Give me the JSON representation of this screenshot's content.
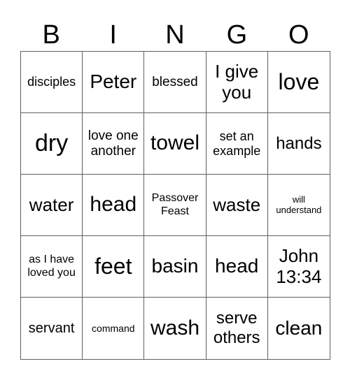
{
  "header": [
    "B",
    "I",
    "N",
    "G",
    "O"
  ],
  "cells": [
    {
      "text": "disciples",
      "size": "s18"
    },
    {
      "text": "Peter",
      "size": "s28"
    },
    {
      "text": "blessed",
      "size": "s19"
    },
    {
      "text": "I give you",
      "size": "s26"
    },
    {
      "text": "love",
      "size": "s32"
    },
    {
      "text": "dry",
      "size": "s34"
    },
    {
      "text": "love one another",
      "size": "s19"
    },
    {
      "text": "towel",
      "size": "s30"
    },
    {
      "text": "set an example",
      "size": "s18"
    },
    {
      "text": "hands",
      "size": "s24"
    },
    {
      "text": "water",
      "size": "s26"
    },
    {
      "text": "head",
      "size": "s30"
    },
    {
      "text": "Passover Feast",
      "size": "s16"
    },
    {
      "text": "waste",
      "size": "s26"
    },
    {
      "text": "will understand",
      "size": "s13"
    },
    {
      "text": "as I have loved you",
      "size": "s16"
    },
    {
      "text": "feet",
      "size": "s32"
    },
    {
      "text": "basin",
      "size": "s28"
    },
    {
      "text": "head",
      "size": "s28"
    },
    {
      "text": "John 13:34",
      "size": "s26"
    },
    {
      "text": "servant",
      "size": "s20"
    },
    {
      "text": "command",
      "size": "s14"
    },
    {
      "text": "wash",
      "size": "s30"
    },
    {
      "text": "serve others",
      "size": "s24"
    },
    {
      "text": "clean",
      "size": "s28"
    }
  ]
}
